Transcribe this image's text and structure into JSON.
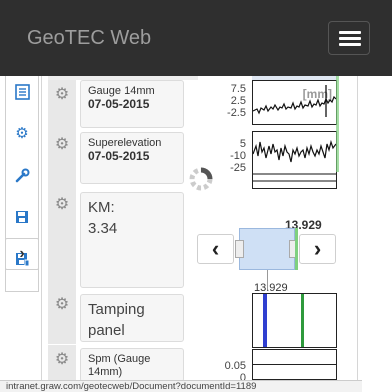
{
  "app": {
    "title": "GeoTEC Web"
  },
  "sidebar": {
    "items": [
      {
        "icon": "document-list-icon"
      },
      {
        "icon": "gear-icon"
      },
      {
        "icon": "wrench-icon"
      },
      {
        "icon": "save-icon"
      },
      {
        "icon": "save-as-icon"
      }
    ],
    "expand_label": "›"
  },
  "channels": [
    {
      "name": "Gauge 14mm",
      "date": "07-05-2015",
      "scale": [
        "7.5",
        "2.5",
        "-2.5"
      ],
      "overlay": "[mm]"
    },
    {
      "name": "Superelevation",
      "date": "07-05-2015",
      "scale": [
        "5",
        "-10",
        "-25"
      ]
    },
    {
      "name": "KM:",
      "value": "3.34"
    },
    {
      "name": "Tamping panel"
    },
    {
      "name": "Spm (Gauge 14mm)",
      "scale": [
        "0.05",
        "0"
      ]
    }
  ],
  "km_navigator": {
    "position_label": "13.929",
    "marker_label": "13.929",
    "prev_label": "‹",
    "next_label": "›"
  },
  "tamping": {
    "lines": [
      {
        "color": "#2f3fd0"
      },
      {
        "color": "#2e9a3c"
      }
    ]
  },
  "status_bar": {
    "url": "intranet.graw.com/geotecweb/Document?documentId=1189"
  }
}
